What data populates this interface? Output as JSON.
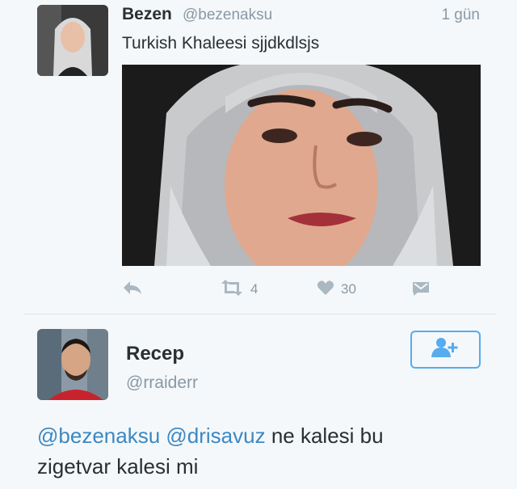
{
  "tweet": {
    "name": "Bezen",
    "handle": "@bezenaksu",
    "time": "1 gün",
    "text": "Turkish Khaleesi sjjdkdlsjs",
    "retweets": "4",
    "likes": "30"
  },
  "reply": {
    "name": "Recep",
    "handle": "@rraiderr",
    "mention1": "@bezenaksu",
    "mention2": "@drisavuz",
    "text_line1_rest": " ne kalesi bu",
    "text_line2": "zigetvar kalesi mi"
  },
  "colors": {
    "accent": "#55acee",
    "mention": "#3b88c3",
    "muted": "#8899a6",
    "text": "#292f33"
  },
  "icons": {
    "reply": "reply-icon",
    "retweet": "retweet-icon",
    "like": "heart-icon",
    "dm": "direct-message-icon",
    "follow": "follow-user-icon"
  }
}
